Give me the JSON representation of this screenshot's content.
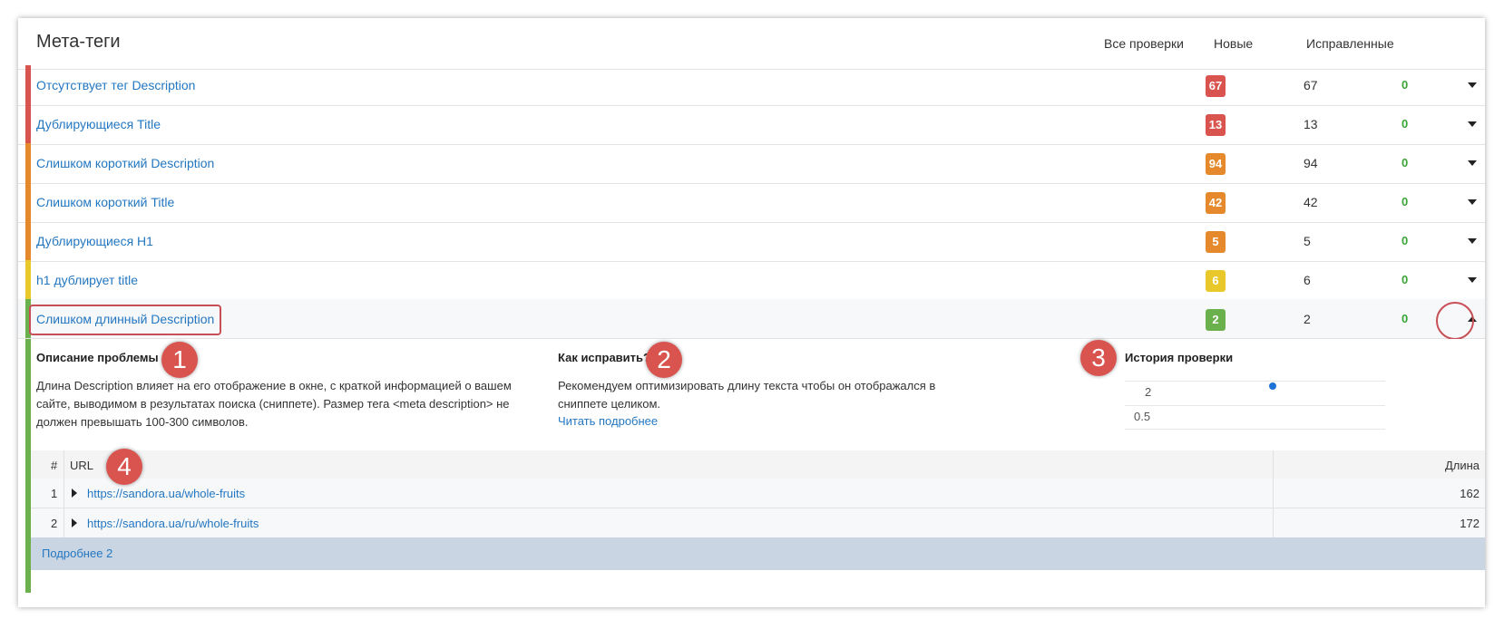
{
  "header": {
    "title": "Мета-теги",
    "col_all": "Все проверки",
    "col_new": "Новые",
    "col_fixed": "Исправленные"
  },
  "rows": [
    {
      "label": "Отсутствует тег Description",
      "all": "67",
      "new": "67",
      "fixed": "0",
      "color": "#d9534f"
    },
    {
      "label": "Дублирующиеся Title",
      "all": "13",
      "new": "13",
      "fixed": "0",
      "color": "#d9534f"
    },
    {
      "label": "Слишком короткий Description",
      "all": "94",
      "new": "94",
      "fixed": "0",
      "color": "#e6892c"
    },
    {
      "label": "Слишком короткий Title",
      "all": "42",
      "new": "42",
      "fixed": "0",
      "color": "#e6892c"
    },
    {
      "label": "Дублирующиеся H1",
      "all": "5",
      "new": "5",
      "fixed": "0",
      "color": "#e6892c"
    },
    {
      "label": "h1 дублирует title",
      "all": "6",
      "new": "6",
      "fixed": "0",
      "color": "#e8c82a"
    },
    {
      "label": "Слишком длинный Description",
      "all": "2",
      "new": "2",
      "fixed": "0",
      "color": "#6ab04c"
    }
  ],
  "details": {
    "problem_title": "Описание проблемы",
    "problem_text": "Длина Description влияет на его отображение в окне, с краткой информацией о вашем сайте, выводимом в результатах поиска (сниппете). Размер тега <meta description> не должен превышать 100-300 символов.",
    "fix_title": "Как исправить?",
    "fix_text": "Рекомендуем оптимизировать длину текста чтобы он отображался в сниппете целиком.",
    "fix_link": "Читать подробнее",
    "history_title": "История проверки",
    "history_y_top": "2",
    "history_y_bottom": "0.5"
  },
  "markers": [
    "1",
    "2",
    "3",
    "4"
  ],
  "table": {
    "col_num": "#",
    "col_url": "URL",
    "col_len": "Длина",
    "rows": [
      {
        "num": "1",
        "url": "https://sandora.ua/whole-fruits",
        "len": "162"
      },
      {
        "num": "2",
        "url": "https://sandora.ua/ru/whole-fruits",
        "len": "172"
      }
    ]
  },
  "more_link": "Подробнее 2",
  "colors": {
    "link": "#2377c1",
    "red": "#d9534f",
    "orange": "#e6892c",
    "yellow": "#e8c82a",
    "green": "#6ab04c",
    "fixed_text": "#3aa335"
  }
}
